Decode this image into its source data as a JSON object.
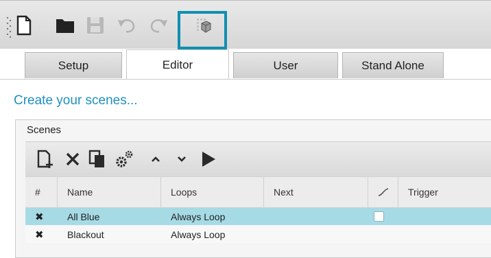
{
  "toolbar": {
    "buttons": [
      "new-file-icon",
      "open-folder-icon",
      "save-icon",
      "undo-icon",
      "redo-icon",
      "export-cube-icon"
    ]
  },
  "tabs": [
    {
      "label": "Setup",
      "active": false
    },
    {
      "label": "Editor",
      "active": true
    },
    {
      "label": "User",
      "active": false
    },
    {
      "label": "Stand Alone",
      "active": false
    }
  ],
  "heading": "Create your scenes...",
  "scenes": {
    "title": "Scenes",
    "toolbar": [
      "add-scene-icon",
      "delete-scene-icon",
      "copy-scene-icon",
      "settings-gears-icon",
      "move-up-icon",
      "move-down-icon",
      "play-icon"
    ],
    "columns": [
      "#",
      "Name",
      "Loops",
      "Next",
      "",
      "Trigger"
    ],
    "rows": [
      {
        "mark": "✖",
        "name": "All Blue",
        "loops": "Always Loop",
        "next": "",
        "checked": false,
        "selected": true
      },
      {
        "mark": "✖",
        "name": "Blackout",
        "loops": "Always Loop",
        "next": "",
        "checked": false,
        "selected": false
      }
    ]
  },
  "colors": {
    "accent": "#1f8fc0",
    "highlight": "#0f8fb0",
    "selected_row": "#a6dbe6"
  }
}
